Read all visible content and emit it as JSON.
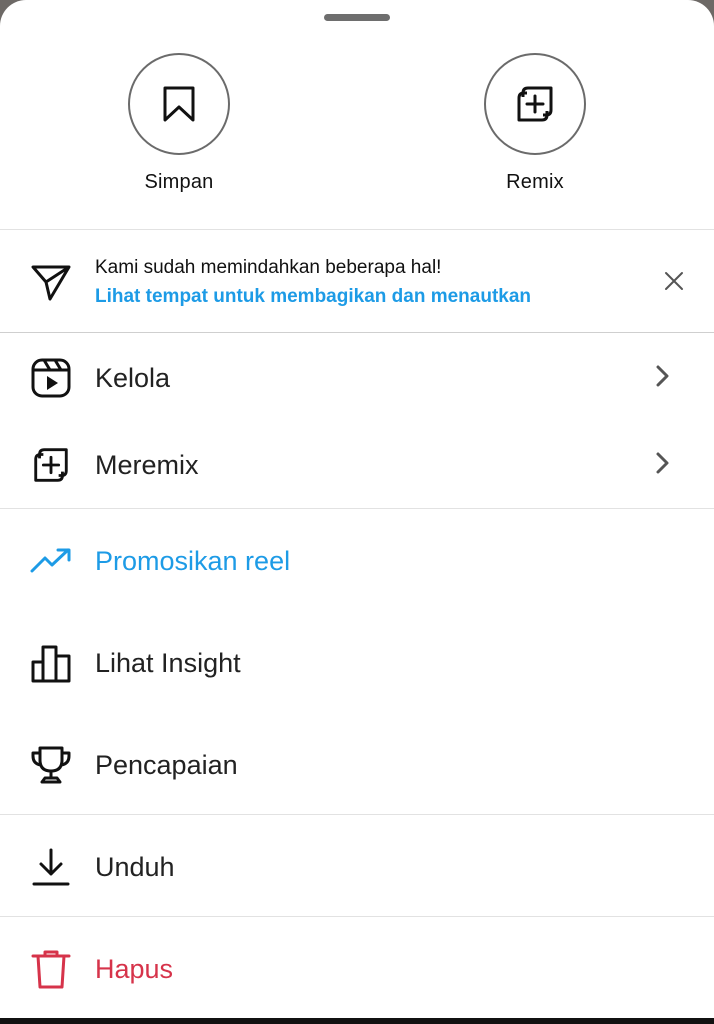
{
  "quick_actions": [
    {
      "label": "Simpan",
      "icon": "bookmark-icon"
    },
    {
      "label": "Remix",
      "icon": "remix-icon"
    }
  ],
  "notice": {
    "text": "Kami sudah memindahkan beberapa hal!",
    "link": "Lihat tempat untuk membagikan dan menautkan",
    "icon": "send-icon",
    "link_color": "#1d9be6"
  },
  "menu": [
    {
      "label": "Kelola",
      "icon": "reels-icon",
      "chevron": true
    },
    {
      "label": "Meremix",
      "icon": "remix-icon",
      "chevron": true
    },
    {
      "label": "Promosikan reel",
      "icon": "trending-up-icon",
      "color": "#1d9be6"
    },
    {
      "label": "Lihat Insight",
      "icon": "bar-chart-icon"
    },
    {
      "label": "Pencapaian",
      "icon": "trophy-icon"
    },
    {
      "label": "Unduh",
      "icon": "download-icon"
    },
    {
      "label": "Hapus",
      "icon": "trash-icon",
      "color": "#d6334a"
    }
  ]
}
